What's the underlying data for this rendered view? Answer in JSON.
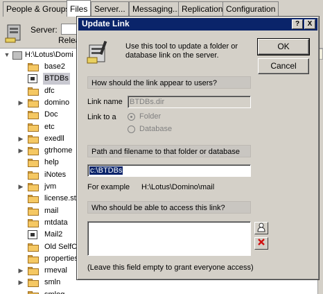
{
  "tabs": [
    "People & Groups",
    "Files",
    "Server...",
    "Messaging...",
    "Replication",
    "Configuration"
  ],
  "server": {
    "label": "Server:",
    "release_label": "Relea"
  },
  "tree": {
    "root": "H:\\Lotus\\Domi",
    "items": [
      {
        "label": "base2",
        "icon": "folder-icon",
        "expandable": false,
        "selected": false
      },
      {
        "label": "BTDBs",
        "icon": "database-link-icon",
        "expandable": false,
        "selected": true
      },
      {
        "label": "dfc",
        "icon": "folder-icon",
        "expandable": false,
        "selected": false
      },
      {
        "label": "domino",
        "icon": "folder-icon",
        "expandable": true,
        "selected": false
      },
      {
        "label": "Doc",
        "icon": "folder-icon",
        "expandable": false,
        "selected": false
      },
      {
        "label": "etc",
        "icon": "folder-icon",
        "expandable": false,
        "selected": false
      },
      {
        "label": "exedll",
        "icon": "folder-icon",
        "expandable": true,
        "selected": false
      },
      {
        "label": "gtrhome",
        "icon": "folder-icon",
        "expandable": true,
        "selected": false
      },
      {
        "label": "help",
        "icon": "folder-icon",
        "expandable": false,
        "selected": false
      },
      {
        "label": "iNotes",
        "icon": "folder-icon",
        "expandable": false,
        "selected": false
      },
      {
        "label": "jvm",
        "icon": "folder-icon",
        "expandable": true,
        "selected": false
      },
      {
        "label": "license.st",
        "icon": "folder-icon",
        "expandable": false,
        "selected": false
      },
      {
        "label": "mail",
        "icon": "folder-icon",
        "expandable": false,
        "selected": false
      },
      {
        "label": "mtdata",
        "icon": "folder-icon",
        "expandable": false,
        "selected": false
      },
      {
        "label": "Mail2",
        "icon": "database-link-icon",
        "expandable": false,
        "selected": false
      },
      {
        "label": "Old SelfCe",
        "icon": "folder-icon",
        "expandable": false,
        "selected": false
      },
      {
        "label": "properties",
        "icon": "folder-icon",
        "expandable": false,
        "selected": false
      },
      {
        "label": "rmeval",
        "icon": "folder-icon",
        "expandable": true,
        "selected": false
      },
      {
        "label": "smln",
        "icon": "folder-icon",
        "expandable": true,
        "selected": false
      },
      {
        "label": "smlog",
        "icon": "folder-icon",
        "expandable": false,
        "selected": false
      }
    ]
  },
  "dialog": {
    "title": "Update Link",
    "help_btn": "?",
    "close_btn": "X",
    "description": "Use this tool to update a folder or database link on the server.",
    "ok_label": "OK",
    "cancel_label": "Cancel",
    "section_appear": "How should the link appear to users?",
    "link_name_label": "Link name",
    "link_name_value": "BTDBs.dir",
    "link_to_label": "Link to a",
    "option_folder": "Folder",
    "option_database": "Database",
    "section_path": "Path and filename to that folder or database",
    "path_value": "c:\\BTDBs",
    "example_label": "For example",
    "example_value": "H:\\Lotus\\Domino\\mail",
    "section_access": "Who should be able to access this link?",
    "access_value": "",
    "footer_note": "(Leave this field empty to grant everyone access)"
  }
}
